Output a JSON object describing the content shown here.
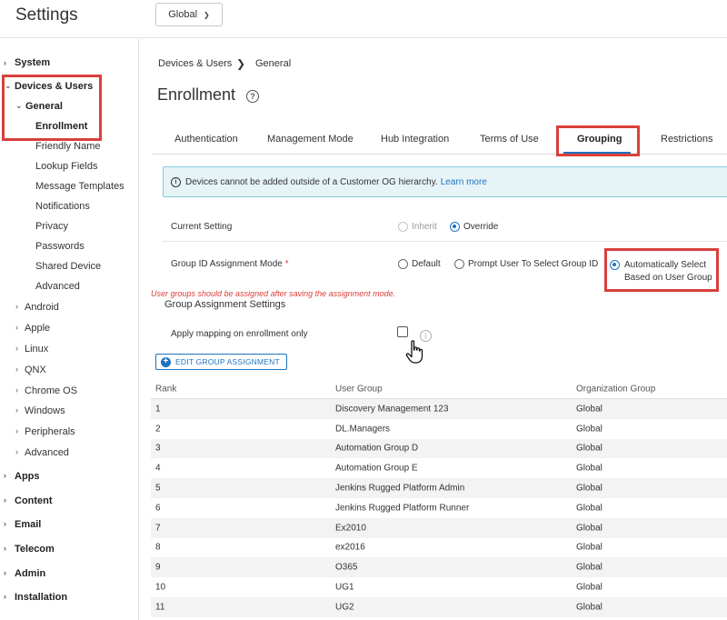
{
  "app": {
    "title": "Settings",
    "scope_label": "Global"
  },
  "sidebar": {
    "system": "System",
    "devices_users": "Devices & Users",
    "general": "General",
    "general_items": [
      "Enrollment",
      "Friendly Name",
      "Lookup Fields",
      "Message Templates",
      "Notifications",
      "Privacy",
      "Passwords",
      "Shared Device",
      "Advanced"
    ],
    "sub_items": [
      "Android",
      "Apple",
      "Linux",
      "QNX",
      "Chrome OS",
      "Windows",
      "Peripherals",
      "Advanced"
    ],
    "top_items": [
      "Apps",
      "Content",
      "Email",
      "Telecom",
      "Admin",
      "Installation"
    ]
  },
  "breadcrumb": {
    "part1": "Devices & Users",
    "part2": "General"
  },
  "page": {
    "title": "Enrollment"
  },
  "tabs": [
    {
      "label": "Authentication"
    },
    {
      "label": "Management Mode"
    },
    {
      "label": "Hub Integration"
    },
    {
      "label": "Terms of Use"
    },
    {
      "label": "Grouping",
      "active": true
    },
    {
      "label": "Restrictions"
    }
  ],
  "info": {
    "text": "Devices cannot be added outside of a Customer OG hierarchy.",
    "link": "Learn more"
  },
  "form": {
    "current_setting_label": "Current Setting",
    "current_setting_options": [
      "Inherit",
      "Override"
    ],
    "current_setting_selected": "Override",
    "group_mode_label": "Group ID Assignment Mode",
    "required_mark": "*",
    "group_mode_options": [
      "Default",
      "Prompt User To Select Group ID"
    ],
    "auto_select_line1": "Automatically Select",
    "auto_select_line2": "Based on User Group",
    "group_mode_selected": "Automatically Select Based on User Group",
    "warning": "User groups should be assigned after saving the assignment mode.",
    "section_title": "Group Assignment Settings",
    "apply_mapping_label": "Apply mapping on enrollment only",
    "apply_mapping_checked": false,
    "edit_button": "EDIT GROUP ASSIGNMENT"
  },
  "table": {
    "headers": [
      "Rank",
      "User Group",
      "Organization Group"
    ],
    "rows": [
      [
        "1",
        "Discovery Management 123",
        "Global"
      ],
      [
        "2",
        "DL.Managers",
        "Global"
      ],
      [
        "3",
        "Automation Group D",
        "Global"
      ],
      [
        "4",
        "Automation Group E",
        "Global"
      ],
      [
        "5",
        "Jenkins Rugged Platform Admin",
        "Global"
      ],
      [
        "6",
        "Jenkins Rugged Platform Runner",
        "Global"
      ],
      [
        "7",
        "Ex2010",
        "Global"
      ],
      [
        "8",
        "ex2016",
        "Global"
      ],
      [
        "9",
        "O365",
        "Global"
      ],
      [
        "10",
        "UG1",
        "Global"
      ],
      [
        "11",
        "UG2",
        "Global"
      ]
    ]
  },
  "colors": {
    "accent": "#1e73be",
    "highlight_box": "#d9403a",
    "info_bg": "#e6f4f8"
  }
}
